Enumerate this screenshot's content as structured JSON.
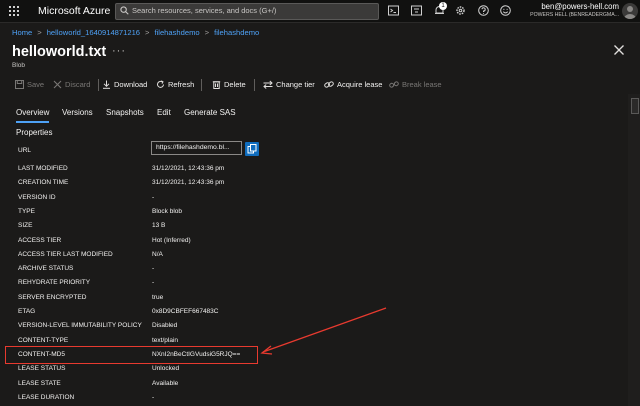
{
  "topbar": {
    "brand": "Microsoft Azure",
    "search_placeholder": "Search resources, services, and docs (G+/)",
    "notifications_badge": "1",
    "user_email": "ben@powers-hell.com",
    "user_org": "POWERS HELL (BENREADERGMA...",
    "icons": [
      "cloud-shell-icon",
      "directory-filter-icon",
      "bell-icon",
      "gear-icon",
      "help-icon",
      "feedback-icon"
    ]
  },
  "breadcrumb": [
    "Home",
    "helloworld_1640914871216",
    "filehashdemo",
    "filehashdemo"
  ],
  "header": {
    "title": "helloworld.txt",
    "more": "···",
    "subtitle": "Blob"
  },
  "toolbar": {
    "save": "Save",
    "discard": "Discard",
    "download": "Download",
    "refresh": "Refresh",
    "delete": "Delete",
    "change_tier": "Change tier",
    "acquire_lease": "Acquire lease",
    "break_lease": "Break lease"
  },
  "tabs": [
    "Overview",
    "Versions",
    "Snapshots",
    "Edit",
    "Generate SAS"
  ],
  "properties": {
    "heading": "Properties",
    "url_label": "URL",
    "url_value": "https://filehashdemo.bl...",
    "rows": [
      {
        "k": "LAST MODIFIED",
        "v": "31/12/2021, 12:43:36 pm"
      },
      {
        "k": "CREATION TIME",
        "v": "31/12/2021, 12:43:36 pm"
      },
      {
        "k": "VERSION ID",
        "v": "-"
      },
      {
        "k": "TYPE",
        "v": "Block blob"
      },
      {
        "k": "SIZE",
        "v": "13 B"
      },
      {
        "k": "ACCESS TIER",
        "v": "Hot (Inferred)"
      },
      {
        "k": "ACCESS TIER LAST MODIFIED",
        "v": "N/A"
      },
      {
        "k": "ARCHIVE STATUS",
        "v": "-"
      },
      {
        "k": "REHYDRATE PRIORITY",
        "v": "-"
      },
      {
        "k": "SERVER ENCRYPTED",
        "v": "true"
      },
      {
        "k": "ETAG",
        "v": "0x8D9CBFEF667483C"
      },
      {
        "k": "VERSION-LEVEL IMMUTABILITY POLICY",
        "v": "Disabled"
      },
      {
        "k": "CONTENT-TYPE",
        "v": "text/plain"
      },
      {
        "k": "CONTENT-MD5",
        "v": "NXnI2nBeCtIGVudsiG5RJQ=="
      },
      {
        "k": "LEASE STATUS",
        "v": "Unlocked"
      },
      {
        "k": "LEASE STATE",
        "v": "Available"
      },
      {
        "k": "LEASE DURATION",
        "v": "-"
      }
    ]
  },
  "colors": {
    "accent": "#4ea1f5",
    "annotation": "#e83a2f",
    "copy_button": "#0f6cbd"
  }
}
